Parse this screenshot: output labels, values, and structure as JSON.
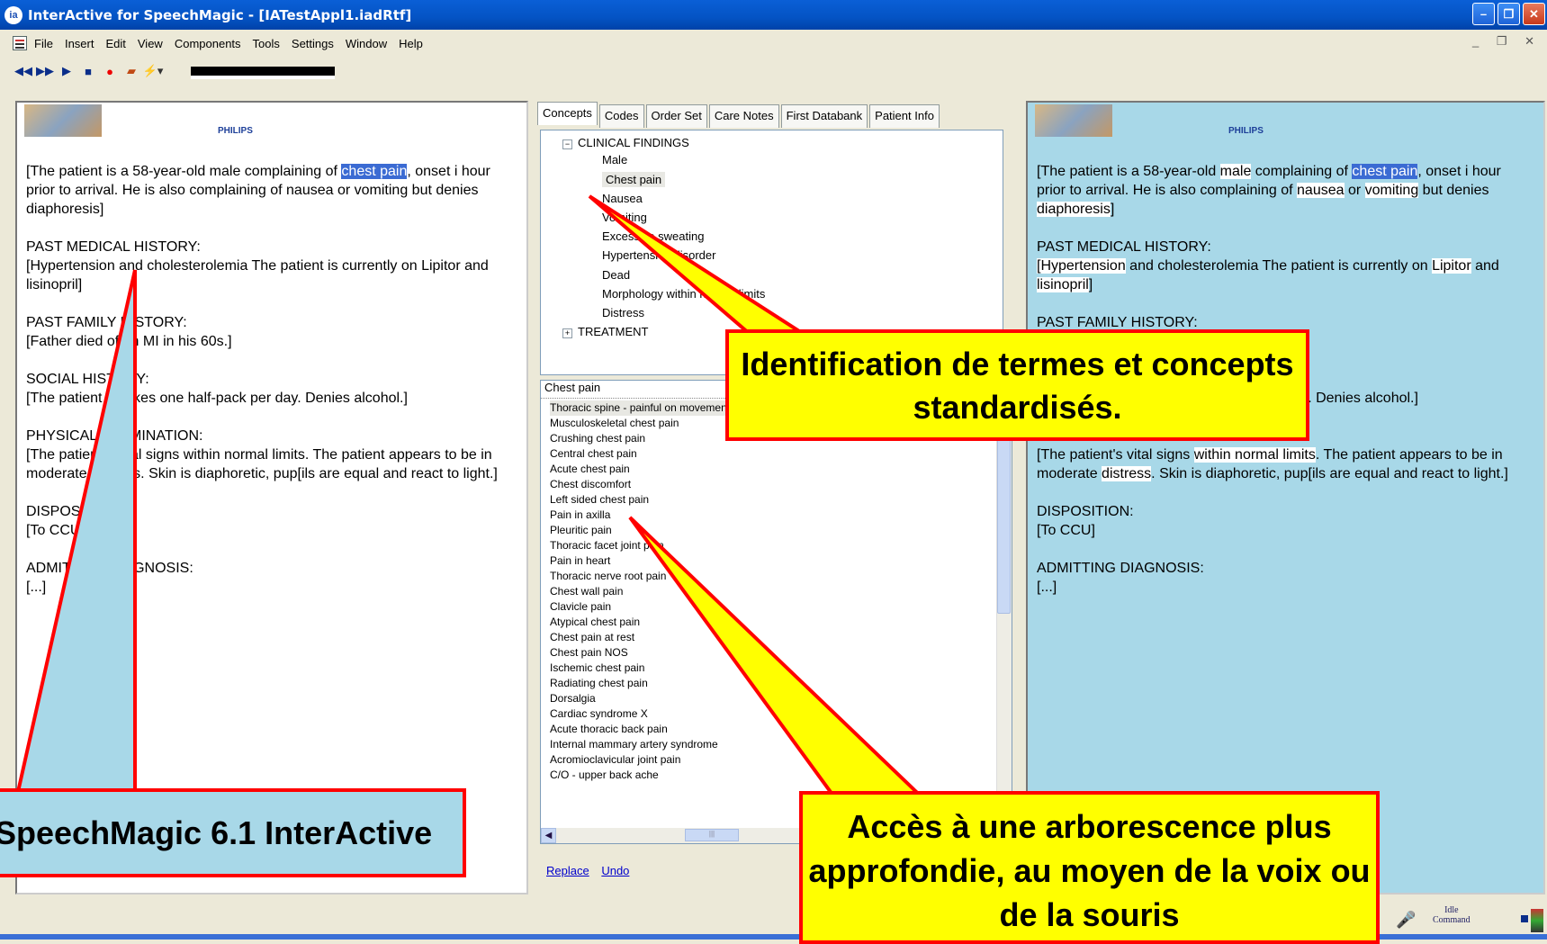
{
  "window": {
    "title": "InterActive for SpeechMagic - [IATestAppl1.iadRtf]",
    "app_icon": "ia"
  },
  "menu": [
    "File",
    "Insert",
    "Edit",
    "View",
    "Components",
    "Tools",
    "Settings",
    "Window",
    "Help"
  ],
  "logo": {
    "brand": "PHILIPS"
  },
  "document": {
    "p1_a": "[The patient is a 58-year-old ",
    "p1_male": "male",
    "p1_b": " complaining of ",
    "p1_hl": "chest pain",
    "p1_c": ", onset i hour prior to arrival.  He is also complaining of ",
    "p1_nausea": "nausea",
    "p1_or": " or ",
    "p1_vomiting": "vomiting",
    "p1_d": " but denies ",
    "p1_diaph": "diaphoresis",
    "p1_e": "]",
    "h2": "PAST MEDICAL HISTORY:",
    "p2_hyper": "[Hypertension",
    "p2_b": " and cholesterolemia  The patient is currently on ",
    "p2_lipitor": "Lipitor",
    "p2_c": " and ",
    "p2_lis": "lisinopril",
    "p2_d": "]",
    "h3": "PAST FAMILY HISTORY:",
    "p3": "[Father died of an MI in his 60s.]",
    "h4": "SOCIAL HISTORY:",
    "p4": "[The patient smokes one half-pack per day.  Denies alcohol.]",
    "h5": "PHYSICAL EXAMINATION:",
    "p5_a": "[The patient's vital signs ",
    "p5_wnl": "within normal limits",
    "p5_b": ".  The patient appears to be in moderate ",
    "p5_distress": "distress",
    "p5_c": ".  Skin is diaphoretic, pup[ils are equal and react to light.]",
    "h6": "DISPOSITION:",
    "p6": "[To CCU]",
    "h7": "ADMITTING DIAGNOSIS:",
    "p7": "[...]"
  },
  "tabs": [
    "Concepts",
    "Codes",
    "Order Set",
    "Care Notes",
    "First Databank",
    "Patient Info"
  ],
  "tree": {
    "root": "CLINICAL FINDINGS",
    "children": [
      "Male",
      "Chest pain",
      "Nausea",
      "Vomiting",
      "Excessive sweating",
      "Hypertensive disorder",
      "Dead",
      "Morphology within normal limits",
      "Distress"
    ],
    "root2": "TREATMENT"
  },
  "list": {
    "header": "Chest pain",
    "items": [
      "Thoracic spine - painful on movement",
      "Musculoskeletal chest pain",
      "Crushing chest pain",
      "Central chest pain",
      "Acute chest pain",
      "Chest discomfort",
      "Left sided chest pain",
      "Pain in axilla",
      "Pleuritic pain",
      "Thoracic facet joint pain",
      "Pain in heart",
      "Thoracic nerve root pain",
      "Chest wall pain",
      "Clavicle pain",
      "Atypical chest pain",
      "Chest pain at rest",
      "Chest pain NOS",
      "Ischemic chest pain",
      "Radiating chest pain",
      "Dorsalgia",
      "Cardiac syndrome X",
      "Acute thoracic back pain",
      "Internal mammary artery syndrome",
      "Acromioclavicular joint pain",
      "C/O - upper back ache"
    ]
  },
  "links": {
    "replace": "Replace",
    "undo": "Undo"
  },
  "status": {
    "state": "Idle",
    "mode": "Command"
  },
  "callouts": {
    "terms": "Identification de termes et concepts standardisés.",
    "product": "SpeechMagic 6.1 InterActive",
    "tree": "Accès à une arborescence plus approfondie, au moyen de la voix ou de la souris"
  },
  "colors": {
    "highlight": "#3b6bd3",
    "callout_fill": "#ffff00",
    "callout_border": "#ff0000",
    "right_pane": "#a8d8e8"
  }
}
